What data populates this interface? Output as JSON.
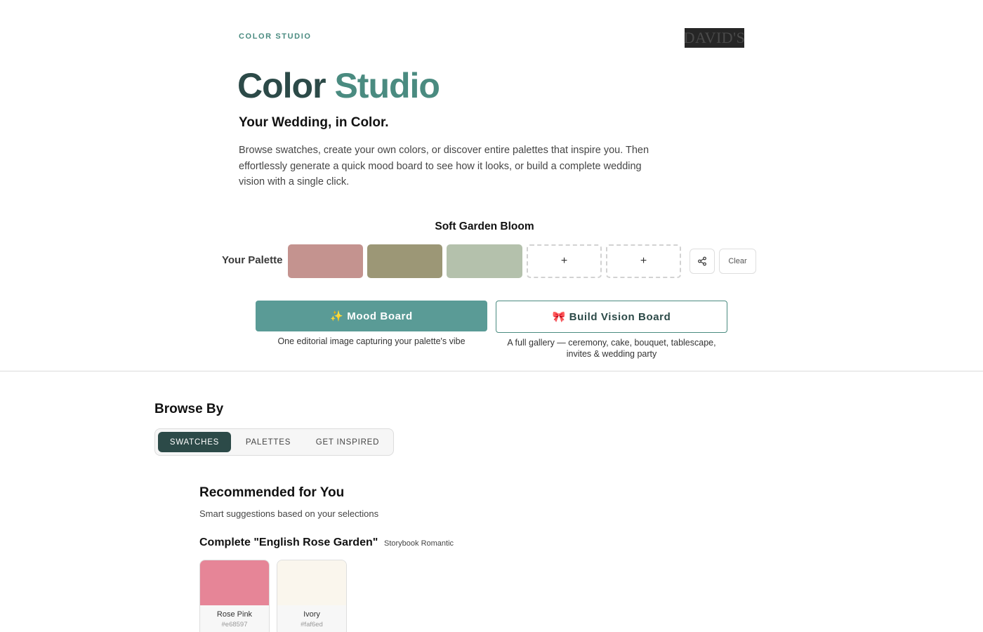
{
  "header": {
    "eyebrow": "COLOR STUDIO",
    "logo_text": "DAVID'S"
  },
  "hero": {
    "title_part1": "Color",
    "title_part2": "Studio",
    "tagline": "Your Wedding, in Color.",
    "description": "Browse swatches, create your own colors, or discover entire palettes that inspire you. Then effortlessly generate a quick mood board to see how it looks, or build a complete wedding vision with a single click."
  },
  "palette": {
    "name": "Soft Garden Bloom",
    "label": "Your Palette",
    "slots": [
      {
        "color": "#c4938f",
        "filled": true
      },
      {
        "color": "#9c9776",
        "filled": true
      },
      {
        "color": "#b4c1ac",
        "filled": true
      },
      {
        "filled": false,
        "label": "+"
      },
      {
        "filled": false,
        "label": "+"
      }
    ],
    "share_icon": "share-icon",
    "clear_label": "Clear"
  },
  "actions": {
    "mood_board_label": "✨ Mood Board",
    "mood_board_caption": "One editorial image capturing your palette's vibe",
    "vision_board_label": "🎀 Build Vision Board",
    "vision_board_caption_line1": "A full gallery — ceremony, cake, bouquet, tablescape,",
    "vision_board_caption_line2": "invites & wedding party"
  },
  "browse": {
    "title": "Browse By",
    "tabs": [
      {
        "label": "SWATCHES",
        "active": true
      },
      {
        "label": "PALETTES",
        "active": false
      },
      {
        "label": "GET INSPIRED",
        "active": false
      }
    ]
  },
  "recommended": {
    "title": "Recommended for You",
    "subtitle": "Smart suggestions based on your selections",
    "complete_title": "Complete \"English Rose Garden\"",
    "complete_badge": "Storybook Romantic",
    "swatches": [
      {
        "name": "Rose Pink",
        "hex": "#e68597"
      },
      {
        "name": "Ivory",
        "hex": "#faf6ed"
      }
    ]
  },
  "colors": {
    "accent": "#4a8b80",
    "dark_teal": "#2c4a48",
    "mood_button": "#5a9b96"
  }
}
